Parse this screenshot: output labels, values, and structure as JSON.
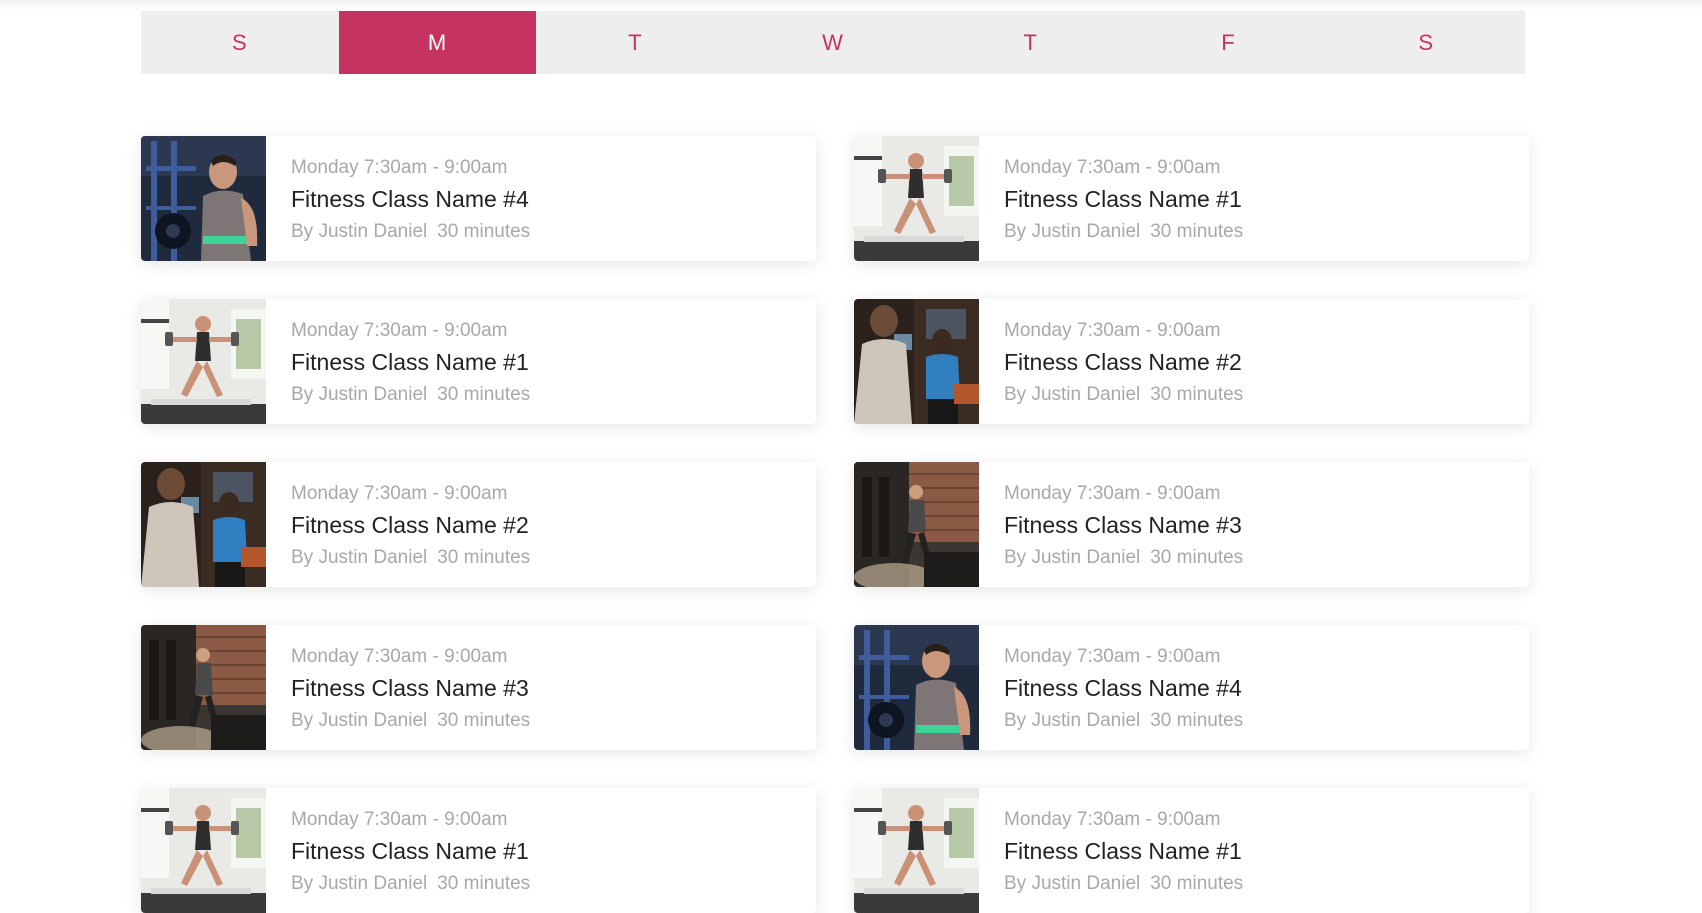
{
  "day_tabs": [
    {
      "label": "S",
      "active": false
    },
    {
      "label": "M",
      "active": true
    },
    {
      "label": "T",
      "active": false
    },
    {
      "label": "W",
      "active": false
    },
    {
      "label": "T",
      "active": false
    },
    {
      "label": "F",
      "active": false
    },
    {
      "label": "S",
      "active": false
    }
  ],
  "colors": {
    "accent": "#c73360",
    "tab_background": "#eeeeee",
    "muted_text": "#a8a8a8",
    "title_text": "#222222"
  },
  "classes": [
    {
      "time": "Monday 7:30am - 9:00am",
      "name": "Fitness Class Name #4",
      "instructor": "By Justin Daniel",
      "duration": "30 minutes",
      "photo": "man-with-dumbbell-photo"
    },
    {
      "time": "Monday 7:30am - 9:00am",
      "name": "Fitness Class Name #1",
      "instructor": "By Justin Daniel",
      "duration": "30 minutes",
      "photo": "woman-lunge-weights-photo"
    },
    {
      "time": "Monday 7:30am - 9:00am",
      "name": "Fitness Class Name #1",
      "instructor": "By Justin Daniel",
      "duration": "30 minutes",
      "photo": "woman-lunge-weights-photo"
    },
    {
      "time": "Monday 7:30am - 9:00am",
      "name": "Fitness Class Name #2",
      "instructor": "By Justin Daniel",
      "duration": "30 minutes",
      "photo": "boxing-training-photo"
    },
    {
      "time": "Monday 7:30am - 9:00am",
      "name": "Fitness Class Name #2",
      "instructor": "By Justin Daniel",
      "duration": "30 minutes",
      "photo": "boxing-training-photo"
    },
    {
      "time": "Monday 7:30am - 9:00am",
      "name": "Fitness Class Name #3",
      "instructor": "By Justin Daniel",
      "duration": "30 minutes",
      "photo": "gym-brick-wall-photo"
    },
    {
      "time": "Monday 7:30am - 9:00am",
      "name": "Fitness Class Name #3",
      "instructor": "By Justin Daniel",
      "duration": "30 minutes",
      "photo": "gym-brick-wall-photo"
    },
    {
      "time": "Monday 7:30am - 9:00am",
      "name": "Fitness Class Name #4",
      "instructor": "By Justin Daniel",
      "duration": "30 minutes",
      "photo": "man-with-dumbbell-photo"
    },
    {
      "time": "Monday 7:30am - 9:00am",
      "name": "Fitness Class Name #1",
      "instructor": "By Justin Daniel",
      "duration": "30 minutes",
      "photo": "woman-lunge-weights-photo"
    },
    {
      "time": "Monday 7:30am - 9:00am",
      "name": "Fitness Class Name #1",
      "instructor": "By Justin Daniel",
      "duration": "30 minutes",
      "photo": "woman-lunge-weights-photo"
    }
  ]
}
